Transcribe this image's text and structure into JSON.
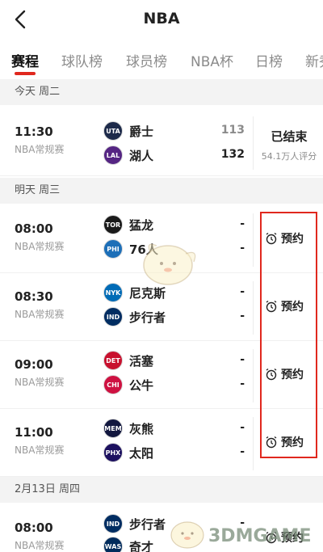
{
  "header": {
    "title": "NBA",
    "back_icon": "chevron-left-icon"
  },
  "tabs": [
    {
      "label": "赛程",
      "active": true
    },
    {
      "label": "球队榜",
      "active": false
    },
    {
      "label": "球员榜",
      "active": false
    },
    {
      "label": "NBA杯",
      "active": false
    },
    {
      "label": "日榜",
      "active": false
    },
    {
      "label": "新秀",
      "active": false
    }
  ],
  "days": [
    {
      "date_label": "今天 周二",
      "matches": [
        {
          "time": "11:30",
          "league": "NBA常规赛",
          "home": {
            "name": "爵士",
            "logo": "UTA",
            "score": "113",
            "lost": true
          },
          "away": {
            "name": "湖人",
            "logo": "LAL",
            "score": "132",
            "lost": false
          },
          "status": "已结束",
          "rating": "54.1万人评分"
        }
      ]
    },
    {
      "date_label": "明天 周三",
      "matches": [
        {
          "time": "08:00",
          "league": "NBA常规赛",
          "home": {
            "name": "猛龙",
            "logo": "TOR",
            "score": "-"
          },
          "away": {
            "name": "76人",
            "logo": "PHI",
            "score": "-"
          },
          "action": "预约"
        },
        {
          "time": "08:30",
          "league": "NBA常规赛",
          "home": {
            "name": "尼克斯",
            "logo": "NYK",
            "score": "-"
          },
          "away": {
            "name": "步行者",
            "logo": "IND",
            "score": "-"
          },
          "action": "预约"
        },
        {
          "time": "09:00",
          "league": "NBA常规赛",
          "home": {
            "name": "活塞",
            "logo": "DET",
            "score": "-"
          },
          "away": {
            "name": "公牛",
            "logo": "CHI",
            "score": "-"
          },
          "action": "预约"
        },
        {
          "time": "11:00",
          "league": "NBA常规赛",
          "home": {
            "name": "灰熊",
            "logo": "MEM",
            "score": "-"
          },
          "away": {
            "name": "太阳",
            "logo": "PHX",
            "score": "-"
          },
          "action": "预约"
        }
      ]
    },
    {
      "date_label": "2月13日 周四",
      "matches": [
        {
          "time": "08:00",
          "league": "NBA常规赛",
          "home": {
            "name": "步行者",
            "logo": "IND",
            "score": "-"
          },
          "away": {
            "name": "奇才",
            "logo": "WAS",
            "score": "-"
          },
          "action": "预约"
        }
      ]
    }
  ],
  "watermark": "3DMGAME",
  "colors": {
    "accent": "#e0281e",
    "uta": "#1d2a4a",
    "lal": "#552583",
    "tor": "#1a1a1a",
    "phi": "#1d6fb8",
    "nyk": "#006bb6",
    "ind": "#002d62",
    "det": "#c8102e",
    "chi": "#ce1141",
    "mem": "#12173f",
    "phx": "#1d1160",
    "was": "#002b5c"
  }
}
